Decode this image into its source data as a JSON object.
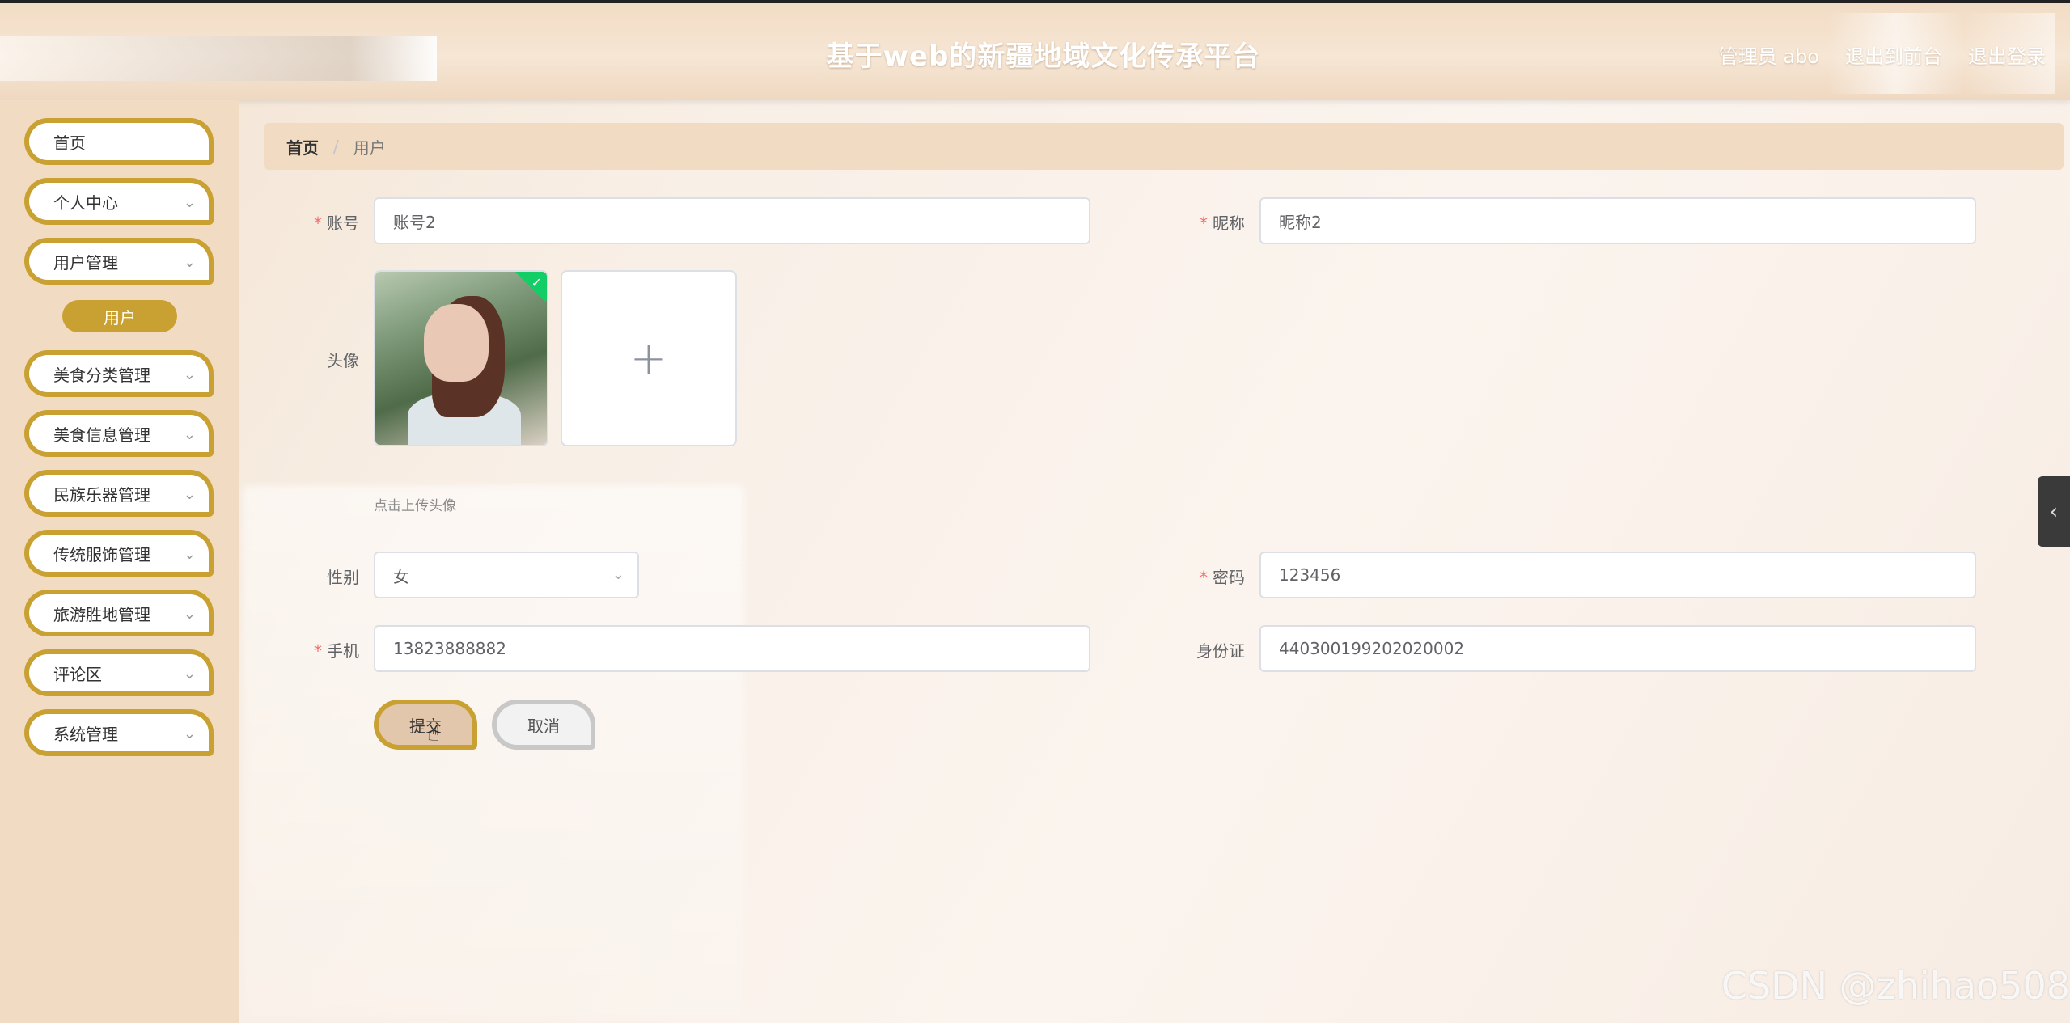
{
  "header": {
    "title": "基于web的新疆地域文化传承平台",
    "admin_label": "管理员 abo",
    "back_to_front": "退出到前台",
    "logout": "退出登录"
  },
  "sidebar": {
    "items": [
      {
        "label": "首页",
        "has_children": false
      },
      {
        "label": "个人中心",
        "has_children": true
      },
      {
        "label": "用户管理",
        "has_children": true
      },
      {
        "label": "美食分类管理",
        "has_children": true
      },
      {
        "label": "美食信息管理",
        "has_children": true
      },
      {
        "label": "民族乐器管理",
        "has_children": true
      },
      {
        "label": "传统服饰管理",
        "has_children": true
      },
      {
        "label": "旅游胜地管理",
        "has_children": true
      },
      {
        "label": "评论区",
        "has_children": true
      },
      {
        "label": "系统管理",
        "has_children": true
      }
    ],
    "active_sub_item": "用户"
  },
  "breadcrumb": {
    "home": "首页",
    "separator": "/",
    "current": "用户"
  },
  "form": {
    "account": {
      "label": "账号",
      "required": true,
      "value": "账号2"
    },
    "nickname": {
      "label": "昵称",
      "required": true,
      "value": "昵称2"
    },
    "avatar": {
      "label": "头像",
      "hint": "点击上传头像",
      "upload_icon": "+"
    },
    "gender": {
      "label": "性别",
      "required": false,
      "value": "女"
    },
    "password": {
      "label": "密码",
      "required": true,
      "value": "123456"
    },
    "phone": {
      "label": "手机",
      "required": true,
      "value": "13823888882"
    },
    "id_card": {
      "label": "身份证",
      "required": false,
      "value": "440300199202020002"
    },
    "required_mark": "*",
    "submit_label": "提交",
    "cancel_label": "取消"
  },
  "icons": {
    "chevron": "chevron-down-icon",
    "side_toggle": "chevron-left-icon",
    "check": "check-icon",
    "plus": "plus-icon"
  },
  "colors": {
    "accent": "#c9a132",
    "sidebar_bg": "#f1dcc3",
    "required": "#f56c6c",
    "success": "#13ce66"
  },
  "watermark": "CSDN @zhihao508"
}
